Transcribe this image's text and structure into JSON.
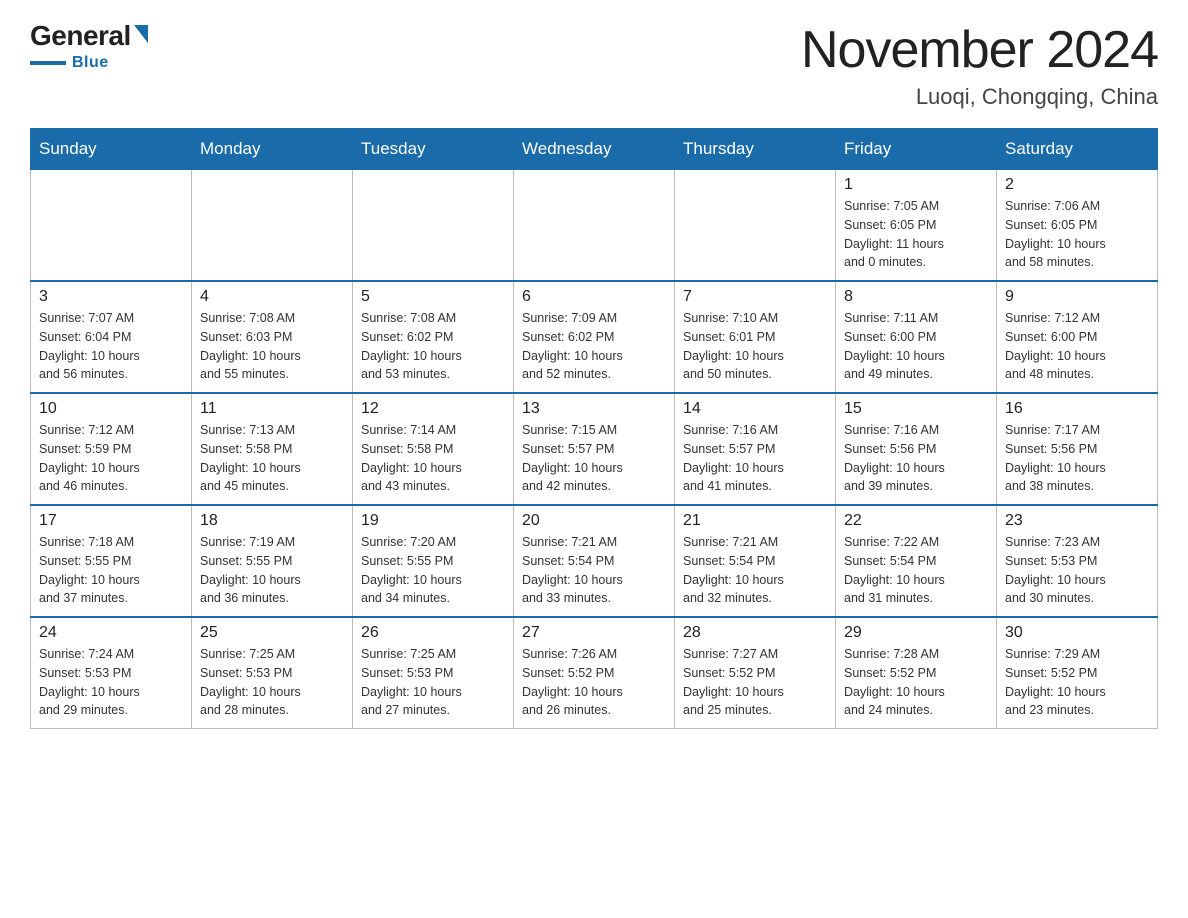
{
  "header": {
    "logo": {
      "general": "General",
      "blue": "Blue"
    },
    "month": "November 2024",
    "location": "Luoqi, Chongqing, China"
  },
  "days_of_week": [
    "Sunday",
    "Monday",
    "Tuesday",
    "Wednesday",
    "Thursday",
    "Friday",
    "Saturday"
  ],
  "weeks": [
    [
      {
        "day": "",
        "info": ""
      },
      {
        "day": "",
        "info": ""
      },
      {
        "day": "",
        "info": ""
      },
      {
        "day": "",
        "info": ""
      },
      {
        "day": "",
        "info": ""
      },
      {
        "day": "1",
        "info": "Sunrise: 7:05 AM\nSunset: 6:05 PM\nDaylight: 11 hours\nand 0 minutes."
      },
      {
        "day": "2",
        "info": "Sunrise: 7:06 AM\nSunset: 6:05 PM\nDaylight: 10 hours\nand 58 minutes."
      }
    ],
    [
      {
        "day": "3",
        "info": "Sunrise: 7:07 AM\nSunset: 6:04 PM\nDaylight: 10 hours\nand 56 minutes."
      },
      {
        "day": "4",
        "info": "Sunrise: 7:08 AM\nSunset: 6:03 PM\nDaylight: 10 hours\nand 55 minutes."
      },
      {
        "day": "5",
        "info": "Sunrise: 7:08 AM\nSunset: 6:02 PM\nDaylight: 10 hours\nand 53 minutes."
      },
      {
        "day": "6",
        "info": "Sunrise: 7:09 AM\nSunset: 6:02 PM\nDaylight: 10 hours\nand 52 minutes."
      },
      {
        "day": "7",
        "info": "Sunrise: 7:10 AM\nSunset: 6:01 PM\nDaylight: 10 hours\nand 50 minutes."
      },
      {
        "day": "8",
        "info": "Sunrise: 7:11 AM\nSunset: 6:00 PM\nDaylight: 10 hours\nand 49 minutes."
      },
      {
        "day": "9",
        "info": "Sunrise: 7:12 AM\nSunset: 6:00 PM\nDaylight: 10 hours\nand 48 minutes."
      }
    ],
    [
      {
        "day": "10",
        "info": "Sunrise: 7:12 AM\nSunset: 5:59 PM\nDaylight: 10 hours\nand 46 minutes."
      },
      {
        "day": "11",
        "info": "Sunrise: 7:13 AM\nSunset: 5:58 PM\nDaylight: 10 hours\nand 45 minutes."
      },
      {
        "day": "12",
        "info": "Sunrise: 7:14 AM\nSunset: 5:58 PM\nDaylight: 10 hours\nand 43 minutes."
      },
      {
        "day": "13",
        "info": "Sunrise: 7:15 AM\nSunset: 5:57 PM\nDaylight: 10 hours\nand 42 minutes."
      },
      {
        "day": "14",
        "info": "Sunrise: 7:16 AM\nSunset: 5:57 PM\nDaylight: 10 hours\nand 41 minutes."
      },
      {
        "day": "15",
        "info": "Sunrise: 7:16 AM\nSunset: 5:56 PM\nDaylight: 10 hours\nand 39 minutes."
      },
      {
        "day": "16",
        "info": "Sunrise: 7:17 AM\nSunset: 5:56 PM\nDaylight: 10 hours\nand 38 minutes."
      }
    ],
    [
      {
        "day": "17",
        "info": "Sunrise: 7:18 AM\nSunset: 5:55 PM\nDaylight: 10 hours\nand 37 minutes."
      },
      {
        "day": "18",
        "info": "Sunrise: 7:19 AM\nSunset: 5:55 PM\nDaylight: 10 hours\nand 36 minutes."
      },
      {
        "day": "19",
        "info": "Sunrise: 7:20 AM\nSunset: 5:55 PM\nDaylight: 10 hours\nand 34 minutes."
      },
      {
        "day": "20",
        "info": "Sunrise: 7:21 AM\nSunset: 5:54 PM\nDaylight: 10 hours\nand 33 minutes."
      },
      {
        "day": "21",
        "info": "Sunrise: 7:21 AM\nSunset: 5:54 PM\nDaylight: 10 hours\nand 32 minutes."
      },
      {
        "day": "22",
        "info": "Sunrise: 7:22 AM\nSunset: 5:54 PM\nDaylight: 10 hours\nand 31 minutes."
      },
      {
        "day": "23",
        "info": "Sunrise: 7:23 AM\nSunset: 5:53 PM\nDaylight: 10 hours\nand 30 minutes."
      }
    ],
    [
      {
        "day": "24",
        "info": "Sunrise: 7:24 AM\nSunset: 5:53 PM\nDaylight: 10 hours\nand 29 minutes."
      },
      {
        "day": "25",
        "info": "Sunrise: 7:25 AM\nSunset: 5:53 PM\nDaylight: 10 hours\nand 28 minutes."
      },
      {
        "day": "26",
        "info": "Sunrise: 7:25 AM\nSunset: 5:53 PM\nDaylight: 10 hours\nand 27 minutes."
      },
      {
        "day": "27",
        "info": "Sunrise: 7:26 AM\nSunset: 5:52 PM\nDaylight: 10 hours\nand 26 minutes."
      },
      {
        "day": "28",
        "info": "Sunrise: 7:27 AM\nSunset: 5:52 PM\nDaylight: 10 hours\nand 25 minutes."
      },
      {
        "day": "29",
        "info": "Sunrise: 7:28 AM\nSunset: 5:52 PM\nDaylight: 10 hours\nand 24 minutes."
      },
      {
        "day": "30",
        "info": "Sunrise: 7:29 AM\nSunset: 5:52 PM\nDaylight: 10 hours\nand 23 minutes."
      }
    ]
  ]
}
